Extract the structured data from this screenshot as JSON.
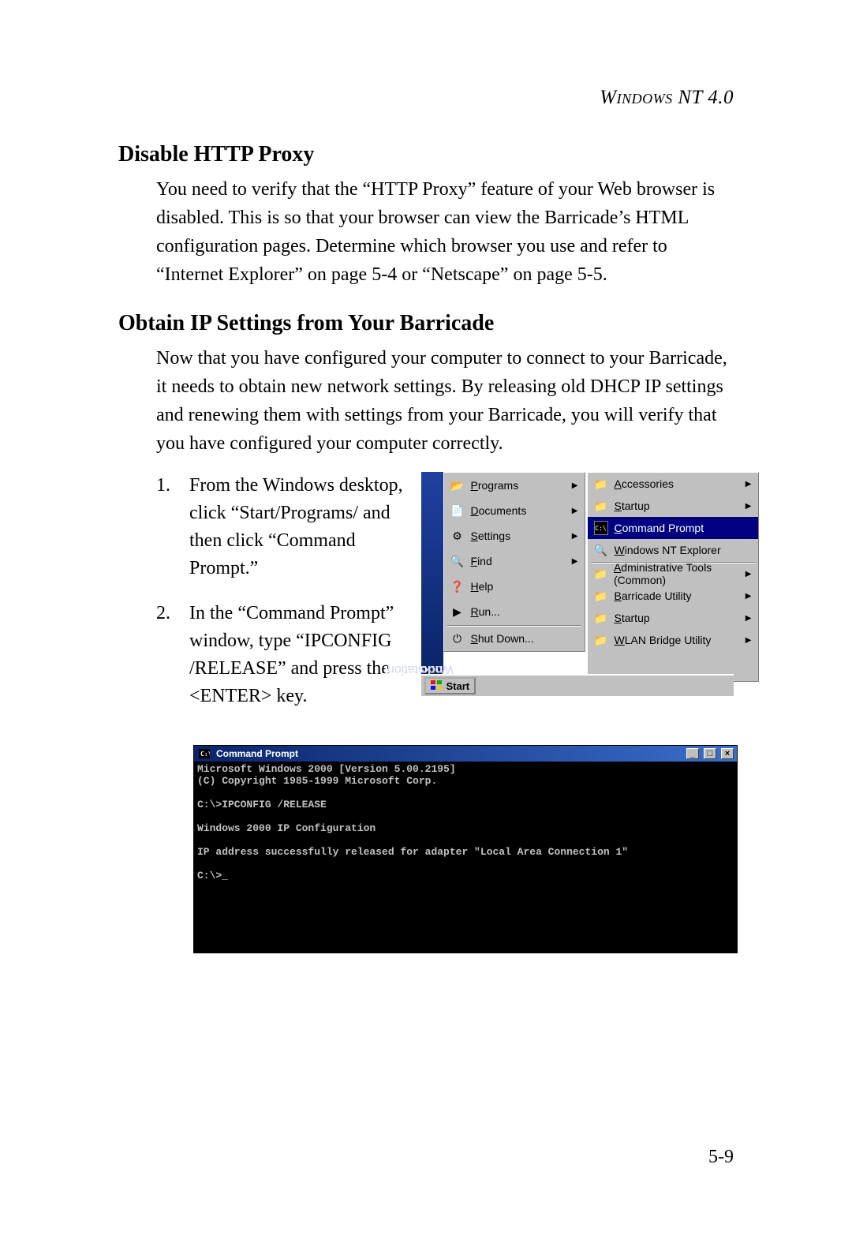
{
  "header": {
    "chapter_label": "Windows NT 4.0"
  },
  "section1": {
    "title": "Disable HTTP Proxy",
    "body": "You need to verify that the “HTTP Proxy” feature of your Web browser is disabled. This is so that your browser can view the Barricade’s HTML configuration pages. Determine which browser you use and refer to “Internet Explorer” on page 5-4 or “Netscape” on page 5-5."
  },
  "section2": {
    "title": "Obtain IP Settings from Your Barricade",
    "intro": "Now that you have configured your computer to connect to your Barricade, it needs to obtain new network settings. By releasing old DHCP IP settings and renewing them with settings from your Barricade, you will verify that you have configured your computer correctly.",
    "steps": [
      "From the Windows desktop, click “Start/Programs/ and then click “Command Prompt.”",
      "In the “Command Prompt” window, type “IPCONFIG /RELEASE” and press the <ENTER> key."
    ]
  },
  "startmenu": {
    "banner_bold": "Windows NT",
    "banner_light": " Workstation",
    "col1": [
      {
        "label": "Programs",
        "icon": "programs",
        "arrow": true
      },
      {
        "label": "Documents",
        "icon": "documents",
        "arrow": true
      },
      {
        "label": "Settings",
        "icon": "settings",
        "arrow": true
      },
      {
        "label": "Find",
        "icon": "find",
        "arrow": true
      },
      {
        "label": "Help",
        "icon": "help"
      },
      {
        "label": "Run...",
        "icon": "run"
      },
      {
        "label": "Shut Down...",
        "icon": "shutdown",
        "sep_above": true,
        "tall": true
      }
    ],
    "col2": [
      {
        "label": "Accessories",
        "icon": "folder",
        "arrow": true
      },
      {
        "label": "Startup",
        "icon": "folder",
        "arrow": true
      },
      {
        "label": "Command Prompt",
        "icon": "cmd",
        "selected": true
      },
      {
        "label": "Windows NT Explorer",
        "icon": "explorer"
      },
      {
        "label": "Administrative Tools (Common)",
        "icon": "folder",
        "arrow": true,
        "sep_above": true
      },
      {
        "label": "Barricade Utility",
        "icon": "folder",
        "arrow": true
      },
      {
        "label": "Startup",
        "icon": "folder",
        "arrow": true
      },
      {
        "label": "WLAN Bridge Utility",
        "icon": "folder",
        "arrow": true
      }
    ],
    "start_label": "Start"
  },
  "cmd": {
    "title": "Command Prompt",
    "lines": "Microsoft Windows 2000 [Version 5.00.2195]\n(C) Copyright 1985-1999 Microsoft Corp.\n\nC:\\>IPCONFIG /RELEASE\n\nWindows 2000 IP Configuration\n\nIP address successfully released for adapter \"Local Area Connection 1\"\n\nC:\\>_"
  },
  "page_number": "5-9",
  "icons": {
    "programs": "📂",
    "documents": "📄",
    "settings": "⚙",
    "find": "🔍",
    "help": "❓",
    "run": "▶",
    "shutdown": "⏻",
    "cmd": "C:\\",
    "explorer": "🔍",
    "folder": "📁"
  }
}
